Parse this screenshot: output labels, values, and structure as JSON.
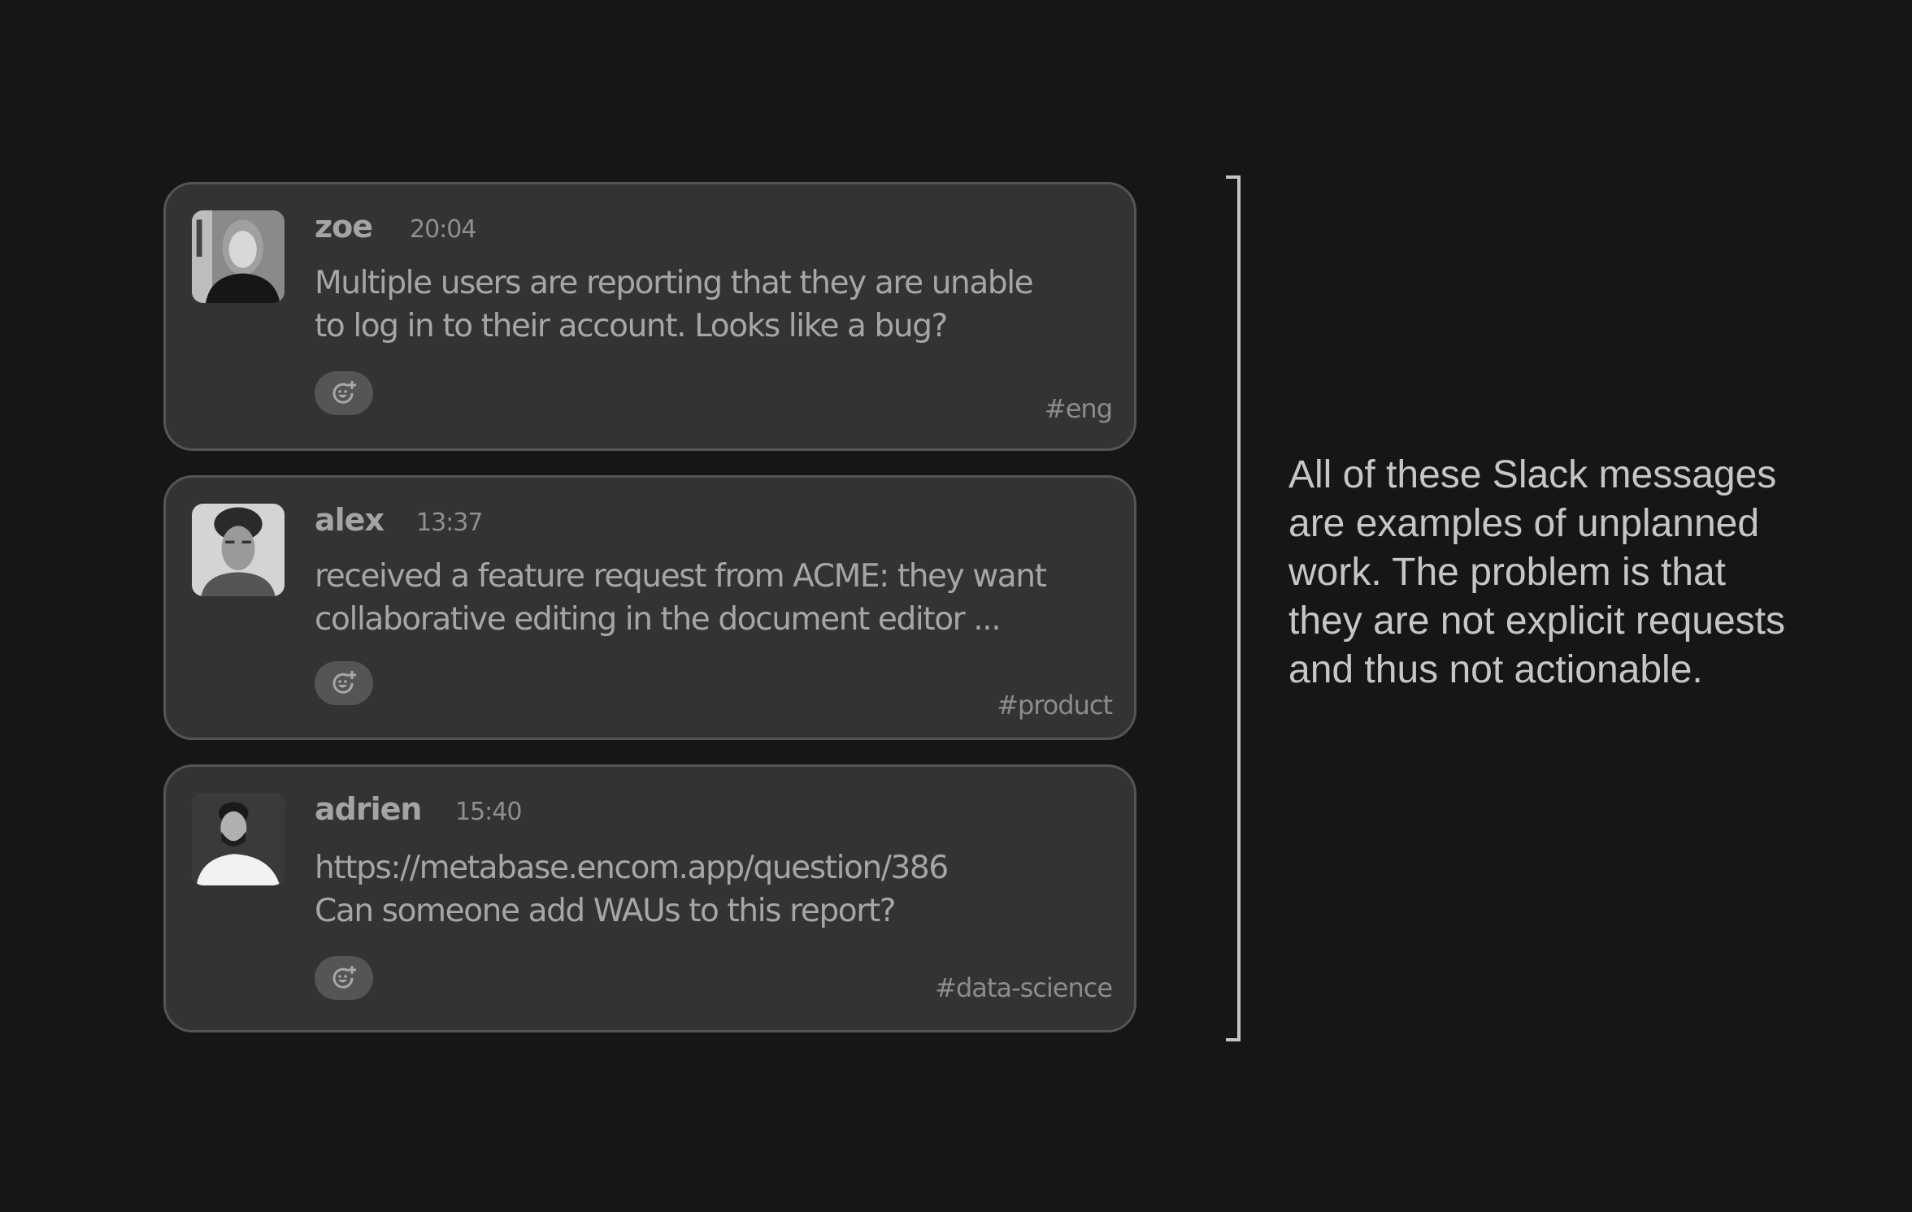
{
  "messages": [
    {
      "author": "zoe",
      "time": "20:04",
      "text": "Multiple users are reporting that they are unable\nto  log in to their account. Looks like a bug?",
      "channel": "#eng",
      "avatar": "zoe-avatar-photo",
      "reaction_icon": "add-reaction-icon"
    },
    {
      "author": "alex",
      "time": "13:37",
      "text": "received a feature request from ACME: they want\ncollaborative editing in the document editor ...",
      "channel": "#product",
      "avatar": "alex-avatar-photo",
      "reaction_icon": "add-reaction-icon"
    },
    {
      "author": "adrien",
      "time": "15:40",
      "text": "https://metabase.encom.app/question/386\nCan someone add WAUs to this report?",
      "channel": "#data-science",
      "avatar": "adrien-avatar-photo",
      "reaction_icon": "add-reaction-icon"
    }
  ],
  "annotation": {
    "text": "All of these Slack messages are examples of unplanned work. The problem is that they are not explicit requests and thus not actionable."
  },
  "colors": {
    "background": "#161618",
    "card": "#333335",
    "card_border": "#555557",
    "text": "#a6a6a8",
    "annotation_text": "#c6c6c8"
  }
}
